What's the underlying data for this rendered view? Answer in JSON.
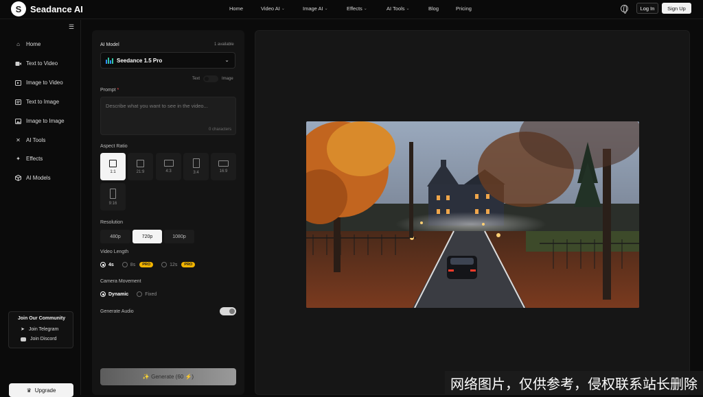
{
  "brand": {
    "logo_letter": "S",
    "name": "Seadance AI"
  },
  "nav": {
    "items": [
      {
        "label": "Home",
        "has_chevron": false
      },
      {
        "label": "Video AI",
        "has_chevron": true
      },
      {
        "label": "Image AI",
        "has_chevron": true
      },
      {
        "label": "Effects",
        "has_chevron": true
      },
      {
        "label": "AI Tools",
        "has_chevron": true
      },
      {
        "label": "Blog",
        "has_chevron": false
      },
      {
        "label": "Pricing",
        "has_chevron": false
      }
    ],
    "login_label": "Log In",
    "signup_label": "Sign Up"
  },
  "sidebar": {
    "items": [
      {
        "label": "Home",
        "icon": "home-icon"
      },
      {
        "label": "Text to Video",
        "icon": "video-icon"
      },
      {
        "label": "Image to Video",
        "icon": "image-video-icon"
      },
      {
        "label": "Text to Image",
        "icon": "text-image-icon"
      },
      {
        "label": "Image to Image",
        "icon": "image-icon"
      },
      {
        "label": "AI Tools",
        "icon": "tools-icon"
      },
      {
        "label": "Effects",
        "icon": "sparkle-icon"
      },
      {
        "label": "AI Models",
        "icon": "cube-icon"
      }
    ],
    "community": {
      "title": "Join Our Community",
      "telegram": "Join Telegram",
      "discord": "Join Discord"
    },
    "upgrade_label": "Upgrade"
  },
  "form": {
    "model_label": "AI Model",
    "available": "1 available",
    "model_name": "Seedance 1.5 Pro",
    "mode_text": "Text",
    "mode_image": "Image",
    "prompt_label": "Prompt",
    "prompt_required": "*",
    "prompt_placeholder": "Describe what you want to see in the video...",
    "prompt_count": "0 characters",
    "aspect_label": "Aspect Ratio",
    "aspect_ratios": [
      "1:1",
      "21:9",
      "4:3",
      "3:4",
      "16:9",
      "9:16"
    ],
    "aspect_selected": "1:1",
    "resolution_label": "Resolution",
    "resolutions": [
      "480p",
      "720p",
      "1080p"
    ],
    "resolution_selected": "720p",
    "length_label": "Video Length",
    "lengths": [
      {
        "label": "4s",
        "pro": false,
        "selected": true
      },
      {
        "label": "8s",
        "pro": true,
        "selected": false
      },
      {
        "label": "12s",
        "pro": true,
        "selected": false
      }
    ],
    "pro_badge": "PRO",
    "camera_label": "Camera Movement",
    "camera_options": [
      {
        "label": "Dynamic",
        "selected": true
      },
      {
        "label": "Fixed",
        "selected": false
      }
    ],
    "audio_label": "Generate Audio",
    "audio_on": true,
    "generate_label": "✨ Generate (60 ⚡)"
  },
  "preview": {
    "scene": "autumn-mansion-driveway-image"
  },
  "watermark": "网络图片，仅供参考，侵权联系站长删除"
}
